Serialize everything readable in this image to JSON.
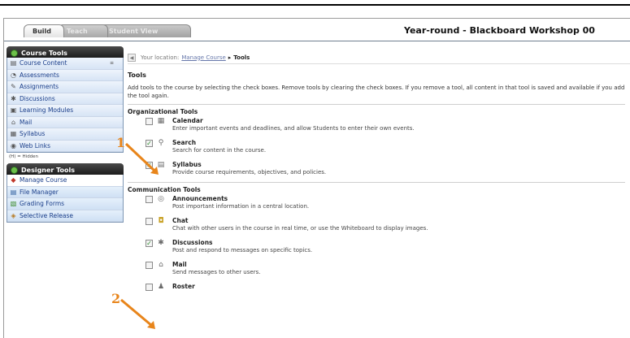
{
  "tabs": [
    {
      "label": "Build"
    },
    {
      "label": "Teach"
    },
    {
      "label": "Student View"
    }
  ],
  "course_title": "Year-round - Blackboard Workshop 00",
  "sidebar": {
    "course_tools_title": "Course Tools",
    "course_tools": [
      {
        "label": "Course Content"
      },
      {
        "label": "Assessments"
      },
      {
        "label": "Assignments"
      },
      {
        "label": "Discussions"
      },
      {
        "label": "Learning Modules"
      },
      {
        "label": "Mail"
      },
      {
        "label": "Syllabus"
      },
      {
        "label": "Web Links"
      }
    ],
    "hidden_note": "(H) = Hidden",
    "designer_tools_title": "Designer Tools",
    "designer_tools": [
      {
        "label": "Manage Course"
      },
      {
        "label": "File Manager"
      },
      {
        "label": "Grading Forms"
      },
      {
        "label": "Selective Release"
      }
    ]
  },
  "breadcrumb": {
    "prefix": "Your location:",
    "link": "Manage Course",
    "separator": "▸",
    "current": "Tools"
  },
  "page_title": "Tools",
  "intro": "Add tools to the course by selecting the check boxes. Remove tools by clearing the check boxes. If you remove a tool, all content in that tool is saved and available if you add the tool again.",
  "groups": [
    {
      "title": "Organizational Tools",
      "tools": [
        {
          "name": "Calendar",
          "desc": "Enter important events and deadlines, and allow Students to enter their own events.",
          "checked": false,
          "icon": "calendar-icon"
        },
        {
          "name": "Search",
          "desc": "Search for content in the course.",
          "checked": true,
          "icon": "search-icon"
        },
        {
          "name": "Syllabus",
          "desc": "Provide course requirements, objectives, and policies.",
          "checked": true,
          "icon": "syllabus-icon"
        }
      ]
    },
    {
      "title": "Communication Tools",
      "tools": [
        {
          "name": "Announcements",
          "desc": "Post important information in a central location.",
          "checked": false,
          "icon": "announcements-icon"
        },
        {
          "name": "Chat",
          "desc": "Chat with other users in the course in real time, or use the Whiteboard to display images.",
          "checked": false,
          "icon": "chat-icon"
        },
        {
          "name": "Discussions",
          "desc": "Post and respond to messages on specific topics.",
          "checked": true,
          "icon": "discussions-icon"
        },
        {
          "name": "Mail",
          "desc": "Send messages to other users.",
          "checked": false,
          "icon": "mail-icon"
        },
        {
          "name": "Roster",
          "desc": "",
          "checked": false,
          "icon": "roster-icon"
        }
      ]
    }
  ],
  "annotations": [
    "1",
    "2"
  ],
  "colors": {
    "annotation": "#e8851b",
    "nav_text": "#1a3e8a",
    "check": "#2a8a2a"
  }
}
